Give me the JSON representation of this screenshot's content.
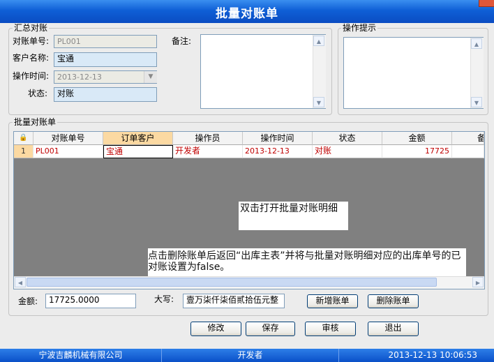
{
  "window": {
    "title": "批量对账单"
  },
  "summary": {
    "group_label": "汇总对账",
    "bill_no_label": "对账单号:",
    "bill_no_value": "PL001",
    "customer_label": "客户名称:",
    "customer_value": "宝通",
    "time_label": "操作时间:",
    "time_value": "2013-12-13",
    "status_label": "状态:",
    "status_value": "对账",
    "remark_label": "备注:"
  },
  "hint": {
    "group_label": "操作提示"
  },
  "batch": {
    "group_label": "批量对账单",
    "columns": [
      "对账单号",
      "订单客户",
      "操作员",
      "操作时间",
      "状态",
      "金额",
      "备"
    ],
    "rows": [
      {
        "index": "1",
        "bill_no": "PL001",
        "customer": "宝通",
        "operator": "开发者",
        "time": "2013-12-13",
        "status": "对账",
        "amount": "17725"
      }
    ],
    "note1": "双击打开批量对账明细",
    "note2": "点击删除账单后返回“出库主表”并将与批量对账明细对应的出库单号的已对账设置为false。"
  },
  "totals": {
    "amount_label": "金额:",
    "amount_value": "17725.0000",
    "capital_label": "大写:",
    "capital_value": "壹万柒仟柒佰贰拾伍元整"
  },
  "buttons": {
    "add_bill": "新增账单",
    "delete_bill": "删除账单",
    "modify": "修改",
    "save": "保存",
    "audit": "审核",
    "exit": "退出"
  },
  "statusbar": {
    "company": "宁波吉麟机械有限公司",
    "user": "开发者",
    "datetime": "2013-12-13 10:06:53"
  },
  "colors": {
    "titlebar": "#0f5fd6",
    "row_text": "#c00000",
    "selected_header": "#fbd9a2"
  }
}
